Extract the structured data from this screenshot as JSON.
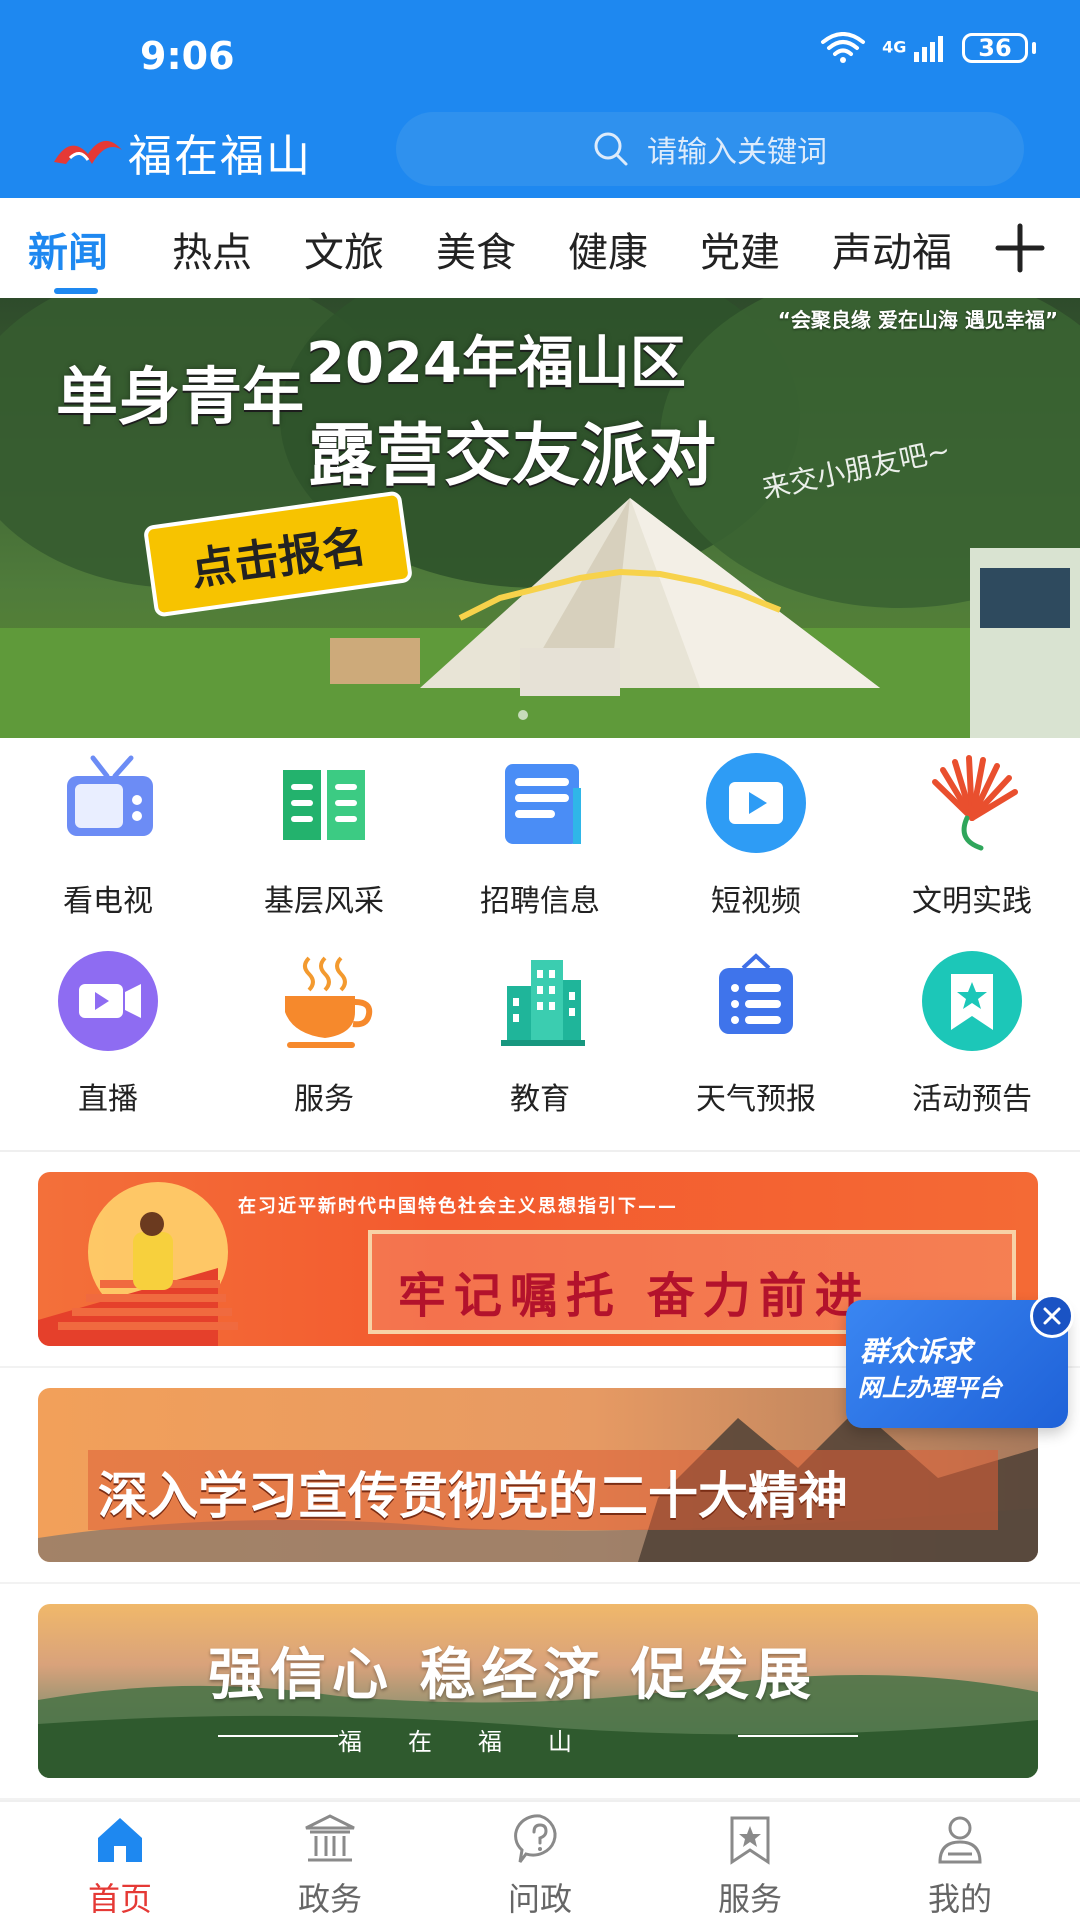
{
  "status_bar": {
    "time": "9:06",
    "network": "4G",
    "battery": "36"
  },
  "header": {
    "app_name": "福在福山",
    "search_placeholder": "请输入关键词"
  },
  "tabs": [
    {
      "label": "新闻",
      "active": true
    },
    {
      "label": "热点"
    },
    {
      "label": "文旅"
    },
    {
      "label": "美食"
    },
    {
      "label": "健康"
    },
    {
      "label": "党建"
    },
    {
      "label": "声动福"
    }
  ],
  "banner": {
    "title_1": "2024年福山区",
    "title_2": "单身青年",
    "title_3": "露营交友派对",
    "slogan": "“会聚良缘 爱在山海 遇见幸福”",
    "note": "来交小朋友吧~",
    "cta": "点击报名"
  },
  "grid": [
    {
      "label": "看电视",
      "icon": "tv-icon"
    },
    {
      "label": "基层风采",
      "icon": "book-icon"
    },
    {
      "label": "招聘信息",
      "icon": "document-icon"
    },
    {
      "label": "短视频",
      "icon": "video-icon"
    },
    {
      "label": "文明实践",
      "icon": "fan-logo-icon"
    },
    {
      "label": "直播",
      "icon": "live-camera-icon"
    },
    {
      "label": "服务",
      "icon": "coffee-cup-icon"
    },
    {
      "label": "教育",
      "icon": "buildings-icon"
    },
    {
      "label": "天气预报",
      "icon": "sign-board-icon"
    },
    {
      "label": "活动预告",
      "icon": "bookmark-star-icon"
    }
  ],
  "promos": [
    {
      "top_line": "在习近平新时代中国特色社会主义思想指引下——",
      "main": "牢记嘱托 奋力前进"
    },
    {
      "main": "深入学习宣传贯彻党的二十大精神"
    },
    {
      "main": "强信心 稳经济 促发展",
      "sub": "福在福山"
    }
  ],
  "floating": {
    "line1": "群众诉求",
    "line2": "网上办理平台"
  },
  "bottom_nav": [
    {
      "label": "首页",
      "active": true,
      "icon": "home-icon"
    },
    {
      "label": "政务",
      "icon": "government-icon"
    },
    {
      "label": "问政",
      "icon": "question-icon"
    },
    {
      "label": "服务",
      "icon": "service-star-icon"
    },
    {
      "label": "我的",
      "icon": "user-icon"
    }
  ],
  "colors": {
    "primary": "#1E88F0",
    "nav_active": "#E53935",
    "text": "#222222"
  }
}
